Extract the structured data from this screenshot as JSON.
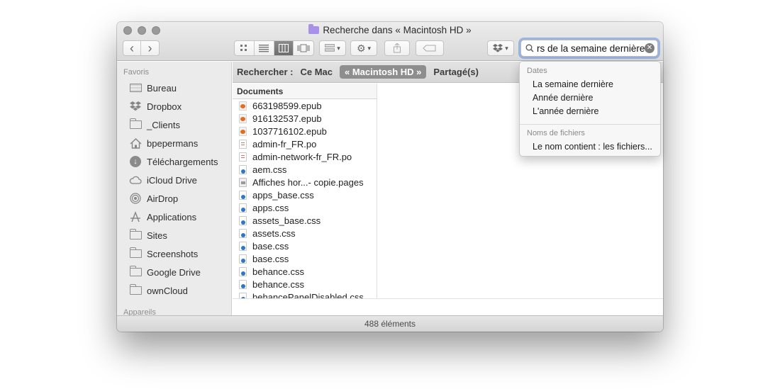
{
  "window": {
    "title": "Recherche dans « Macintosh HD »"
  },
  "toolbar": {
    "nav_back_glyph": "‹",
    "nav_forward_glyph": "›",
    "view_modes": [
      "icon-view-icon",
      "list-view-icon",
      "column-view-icon",
      "coverflow-view-icon"
    ],
    "active_view": "column-view-icon"
  },
  "search": {
    "query": "rs de la semaine dernière",
    "clear_glyph": "✕"
  },
  "sidebar": {
    "favorites_title": "Favoris",
    "devices_title": "Appareils",
    "items": [
      {
        "label": "Bureau",
        "icon": "desktop-icon"
      },
      {
        "label": "Dropbox",
        "icon": "dropbox-icon"
      },
      {
        "label": "_Clients",
        "icon": "folder-icon"
      },
      {
        "label": "bpepermans",
        "icon": "home-icon"
      },
      {
        "label": "Téléchargements",
        "icon": "downloads-icon"
      },
      {
        "label": "iCloud Drive",
        "icon": "cloud-icon"
      },
      {
        "label": "AirDrop",
        "icon": "airdrop-icon"
      },
      {
        "label": "Applications",
        "icon": "applications-icon"
      },
      {
        "label": "Sites",
        "icon": "folder-icon"
      },
      {
        "label": "Screenshots",
        "icon": "folder-icon"
      },
      {
        "label": "Google Drive",
        "icon": "folder-icon"
      },
      {
        "label": "ownCloud",
        "icon": "folder-icon"
      }
    ]
  },
  "scope": {
    "label": "Rechercher :",
    "options": [
      "Ce Mac",
      "« Macintosh HD »",
      "Partagé(s)"
    ],
    "selected": "« Macintosh HD »"
  },
  "column": {
    "header": "Documents",
    "files": [
      {
        "name": "663198599.epub",
        "type": "epub"
      },
      {
        "name": "916132537.epub",
        "type": "epub"
      },
      {
        "name": "1037716102.epub",
        "type": "epub"
      },
      {
        "name": "admin-fr_FR.po",
        "type": "po"
      },
      {
        "name": "admin-network-fr_FR.po",
        "type": "po"
      },
      {
        "name": "aem.css",
        "type": "css"
      },
      {
        "name": "Affiches hor...- copie.pages",
        "type": "pages"
      },
      {
        "name": "apps_base.css",
        "type": "css"
      },
      {
        "name": "apps.css",
        "type": "css"
      },
      {
        "name": "assets_base.css",
        "type": "css"
      },
      {
        "name": "assets.css",
        "type": "css"
      },
      {
        "name": "base.css",
        "type": "css"
      },
      {
        "name": "base.css",
        "type": "css"
      },
      {
        "name": "behance.css",
        "type": "css"
      },
      {
        "name": "behance.css",
        "type": "css"
      },
      {
        "name": "behancePanelDisabled.css",
        "type": "css"
      }
    ]
  },
  "status": {
    "count": "488 éléments"
  },
  "dropdown": {
    "dates_title": "Dates",
    "dates": [
      "La semaine dernière",
      "Année dernière",
      "L'année dernière"
    ],
    "names_title": "Noms de fichiers",
    "names": [
      "Le nom contient : les fichiers..."
    ]
  },
  "colors": {
    "focus_ring": "#608ee0",
    "scope_selected": "#8e8e8e",
    "epub_accent": "#e56b1e",
    "css_accent": "#2e76c9"
  }
}
